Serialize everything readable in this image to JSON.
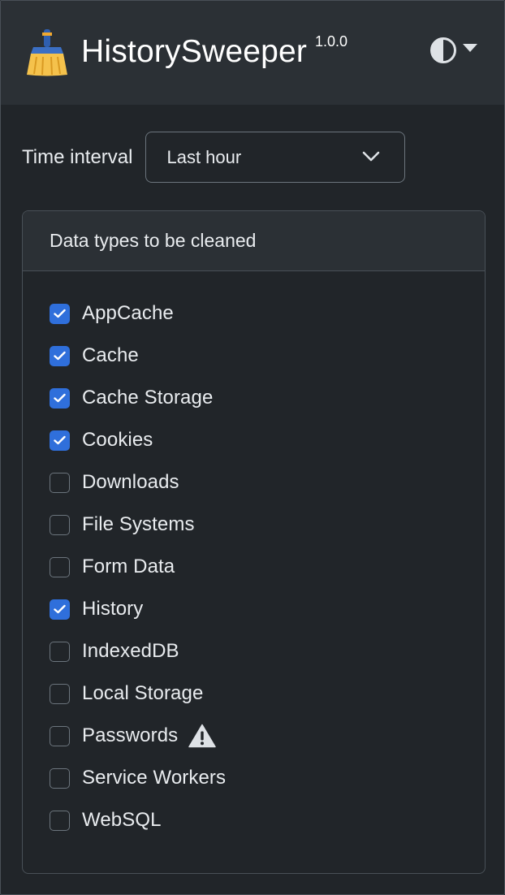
{
  "header": {
    "title": "HistorySweeper",
    "version": "1.0.0",
    "logo_icon": "broom-icon",
    "theme_icon": "contrast-half-icon",
    "menu_icon": "caret-down-icon"
  },
  "time": {
    "label": "Time interval",
    "selected": "Last hour"
  },
  "data_types": {
    "title": "Data types to be cleaned",
    "items": [
      {
        "label": "AppCache",
        "checked": true
      },
      {
        "label": "Cache",
        "checked": true
      },
      {
        "label": "Cache Storage",
        "checked": true
      },
      {
        "label": "Cookies",
        "checked": true
      },
      {
        "label": "Downloads",
        "checked": false
      },
      {
        "label": "File Systems",
        "checked": false
      },
      {
        "label": "Form Data",
        "checked": false
      },
      {
        "label": "History",
        "checked": true
      },
      {
        "label": "IndexedDB",
        "checked": false
      },
      {
        "label": "Local Storage",
        "checked": false
      },
      {
        "label": "Passwords",
        "checked": false,
        "warning": true
      },
      {
        "label": "Service Workers",
        "checked": false
      },
      {
        "label": "WebSQL",
        "checked": false
      }
    ]
  },
  "colors": {
    "accent": "#2f6fdb",
    "background": "#212529",
    "header_bg": "#2b3035",
    "broom_handle": "#3b6fc4",
    "broom_bristles": "#f5c24c"
  }
}
